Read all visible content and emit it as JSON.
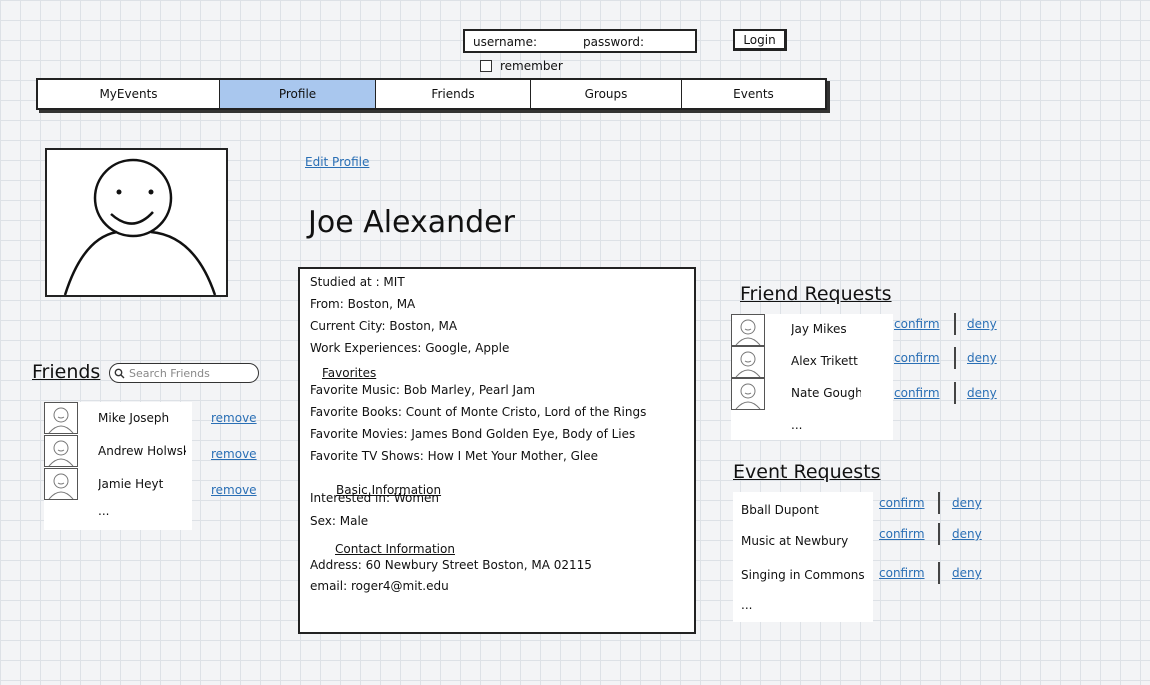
{
  "login": {
    "username_label": "username:",
    "password_label": "password:",
    "remember_label": "remember",
    "login_button": "Login"
  },
  "nav": {
    "tabs": [
      {
        "label": "MyEvents",
        "active": false
      },
      {
        "label": "Profile",
        "active": true
      },
      {
        "label": "Friends",
        "active": false
      },
      {
        "label": "Groups",
        "active": false
      },
      {
        "label": "Events",
        "active": false
      }
    ]
  },
  "profile": {
    "edit_link": "Edit Profile",
    "name": "Joe Alexander"
  },
  "info": {
    "studied": "Studied at : MIT",
    "from": "From: Boston, MA",
    "city": "Current City: Boston, MA",
    "work": "Work Experiences: Google, Apple",
    "favorites_title": "Favorites",
    "music": "Favorite Music: Bob Marley, Pearl Jam",
    "books": "Favorite Books: Count of Monte Cristo, Lord of the Rings",
    "movies": "Favorite Movies: James Bond Golden Eye, Body of Lies",
    "tv": "Favorite TV Shows: How I Met Your Mother, Glee",
    "basic_title": "Basic Information",
    "interested": "Interested in: Women",
    "sex": "Sex: Male",
    "contact_title": "Contact Information",
    "address": "Address: 60 Newbury Street Boston, MA 02115",
    "email": "email: roger4@mit.edu"
  },
  "friends": {
    "title": "Friends",
    "search_placeholder": "Search Friends",
    "items": [
      {
        "name": "Mike Joseph",
        "action": "remove"
      },
      {
        "name": "Andrew Holwsky",
        "action": "remove"
      },
      {
        "name": "Jamie Heyt",
        "action": "remove"
      }
    ],
    "more": "..."
  },
  "friend_requests": {
    "title": "Friend Requests",
    "items": [
      {
        "name": "Jay Mikes",
        "confirm": "confirm",
        "deny": "deny"
      },
      {
        "name": "Alex Trikett",
        "confirm": "confirm",
        "deny": "deny"
      },
      {
        "name": "Nate Gough",
        "confirm": "confirm",
        "deny": "deny"
      }
    ],
    "more": "..."
  },
  "event_requests": {
    "title": "Event Requests",
    "items": [
      {
        "name": "Bball Dupont",
        "confirm": "confirm",
        "deny": "deny"
      },
      {
        "name": "Music at Newbury",
        "confirm": "confirm",
        "deny": "deny"
      },
      {
        "name": "Singing in Commons",
        "confirm": "confirm",
        "deny": "deny"
      }
    ],
    "more": "..."
  }
}
